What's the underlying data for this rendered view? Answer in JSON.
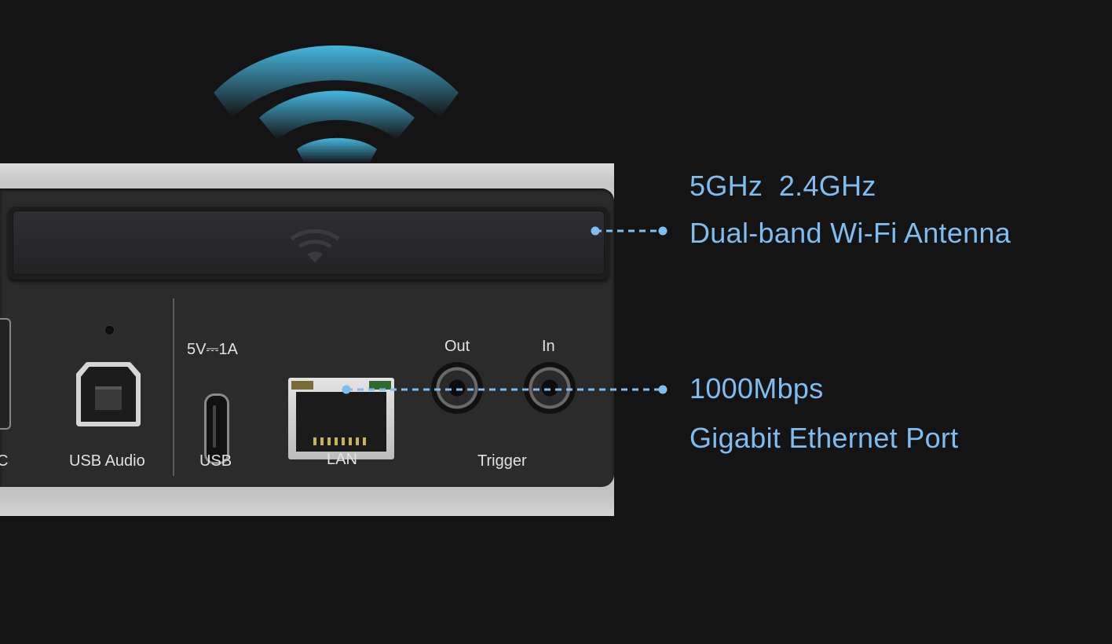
{
  "wifi_callout": {
    "line1": "5GHz  2.4GHz",
    "line2": "Dual-band Wi-Fi Antenna"
  },
  "ethernet_callout": {
    "line1": "1000Mbps",
    "line2": "Gigabit Ethernet Port"
  },
  "ports": {
    "cut_left_label": "C",
    "usb_audio": "USB Audio",
    "usbc_rating": "5V⎓1A",
    "usb": "USB",
    "lan": "LAN",
    "trigger_out": "Out",
    "trigger_in": "In",
    "trigger": "Trigger"
  },
  "colors": {
    "accent": "#7fbdf0",
    "background": "#141414"
  }
}
